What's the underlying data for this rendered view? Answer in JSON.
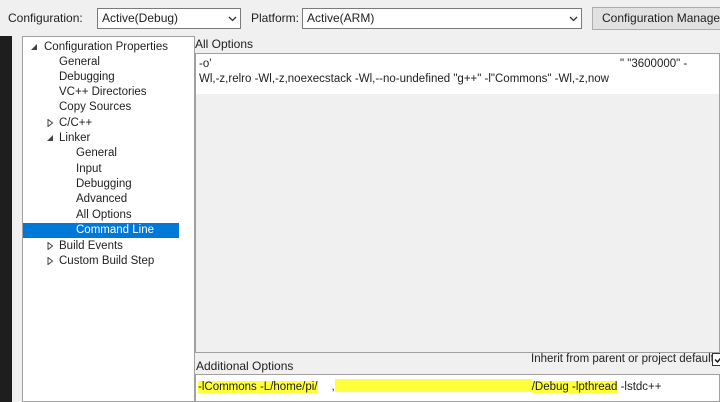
{
  "toolbar": {
    "configuration_label": "Configuration:",
    "configuration_value": "Active(Debug)",
    "platform_label": "Platform:",
    "platform_value": "Active(ARM)",
    "config_manager_label": "Configuration Manager..."
  },
  "tree": {
    "items": [
      {
        "label": "Configuration Properties",
        "expander": "expanded"
      },
      {
        "label": "General"
      },
      {
        "label": "Debugging"
      },
      {
        "label": "VC++ Directories"
      },
      {
        "label": "Copy Sources"
      },
      {
        "label": "C/C++",
        "expander": "collapsed"
      },
      {
        "label": "Linker",
        "expander": "expanded"
      },
      {
        "label": "General"
      },
      {
        "label": "Input"
      },
      {
        "label": "Debugging"
      },
      {
        "label": "Advanced"
      },
      {
        "label": "All Options"
      },
      {
        "label": "Command Line",
        "selected": true
      },
      {
        "label": "Build Events",
        "expander": "collapsed"
      },
      {
        "label": "Custom Build Step",
        "expander": "collapsed"
      }
    ]
  },
  "all_options": {
    "label": "All Options",
    "line1_start": "-o'",
    "line1_end": "\" \"3600000\" -",
    "line2": "Wl,-z,relro -Wl,-z,noexecstack -Wl,--no-undefined \"g++\" -l\"Commons\" -Wl,-z,now"
  },
  "additional_options": {
    "label": "Additional Options",
    "inherit_label": "Inherit from parent or project defaults",
    "inherit_checked": true,
    "value_start": "-lCommons -L/home/pi/",
    "value_mid": ",",
    "value_debug": "/Debug -lpthread",
    "value_end": " -lstdc++"
  },
  "colors": {
    "selection": "#0078d7",
    "highlight": "#ffff3c",
    "background": "#f0f0f0"
  }
}
